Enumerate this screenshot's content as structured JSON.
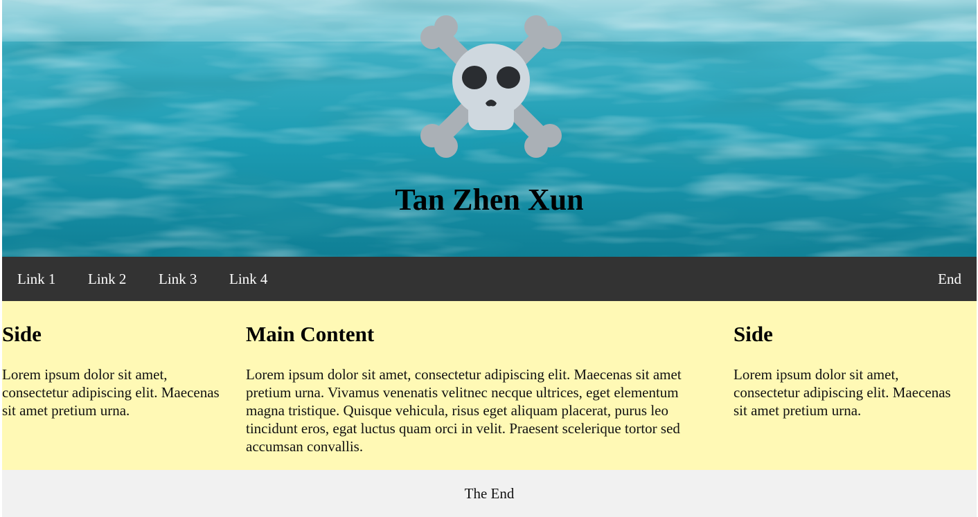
{
  "header": {
    "title": "Tan Zhen Xun",
    "logo_icon": "skull-and-crossbones-icon",
    "background": "underwater-surface-photo"
  },
  "nav": {
    "links": [
      "Link 1",
      "Link 2",
      "Link 3",
      "Link 4"
    ],
    "end_link": "End",
    "background_color": "#333333",
    "text_color": "#ffffff"
  },
  "content": {
    "background_color": "#fff9b5",
    "left_side": {
      "heading": "Side",
      "text": "Lorem ipsum dolor sit amet, consectetur adipiscing elit. Maecenas sit amet pretium urna."
    },
    "main": {
      "heading": "Main Content",
      "text": "Lorem ipsum dolor sit amet, consectetur adipiscing elit. Maecenas sit amet pretium urna. Vivamus venenatis velitnec necque ultrices, eget elementum magna tristique. Quisque vehicula, risus eget aliquam placerat, purus leo tincidunt eros, egat luctus quam orci in velit. Praesent scelerique tortor sed accumsan convallis."
    },
    "right_side": {
      "heading": "Side",
      "text": "Lorem ipsum dolor sit amet, consectetur adipiscing elit. Maecenas sit amet pretium urna."
    }
  },
  "footer": {
    "text": "The End",
    "background_color": "#f1f1f1"
  }
}
